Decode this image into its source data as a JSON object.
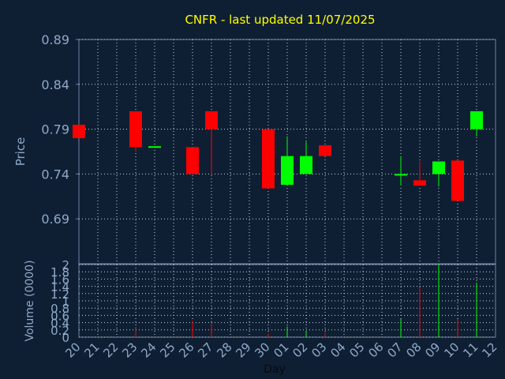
{
  "chart_data": {
    "type": "candlestick",
    "title": "CNFR - last updated 11/07/2025",
    "xlabel": "Day",
    "ylabel_price": "Price",
    "ylabel_volume": "Volume (0000)",
    "price_ylim": [
      0.64,
      0.89
    ],
    "price_ticks": [
      "0.89",
      "0.84",
      "0.79",
      "0.74",
      "0.69"
    ],
    "volume_ylim": [
      0,
      2
    ],
    "volume_ticks": [
      "2",
      "1.8",
      "1.6",
      "1.4",
      "1.2",
      "1",
      "0.8",
      "0.6",
      "0.4",
      "0.2",
      "0"
    ],
    "x_ticks": [
      "20",
      "21",
      "22",
      "23",
      "24",
      "25",
      "26",
      "27",
      "28",
      "29",
      "30",
      "01",
      "02",
      "03",
      "04",
      "05",
      "06",
      "07",
      "08",
      "09",
      "10",
      "11",
      "12"
    ],
    "grid": true,
    "colors": {
      "up": "#00ff00",
      "down": "#ff0000",
      "background": "#0f1f33",
      "text": "#8fa9c8",
      "title": "#ffff00",
      "frame": "#6f86a3"
    },
    "candles": [
      {
        "x": "20",
        "open": 0.795,
        "close": 0.78,
        "high": 0.795,
        "low": 0.78,
        "volume": 0.0
      },
      {
        "x": "23",
        "open": 0.81,
        "close": 0.77,
        "high": 0.81,
        "low": 0.765,
        "volume": 0.2
      },
      {
        "x": "24",
        "open": 0.77,
        "close": 0.771,
        "high": 0.771,
        "low": 0.77,
        "volume": 0.0
      },
      {
        "x": "26",
        "open": 0.77,
        "close": 0.74,
        "high": 0.77,
        "low": 0.74,
        "volume": 0.45
      },
      {
        "x": "27",
        "open": 0.81,
        "close": 0.79,
        "high": 0.81,
        "low": 0.74,
        "volume": 0.38
      },
      {
        "x": "30",
        "open": 0.79,
        "close": 0.724,
        "high": 0.79,
        "low": 0.724,
        "volume": 0.1
      },
      {
        "x": "01",
        "open": 0.728,
        "close": 0.76,
        "high": 0.782,
        "low": 0.728,
        "volume": 0.3
      },
      {
        "x": "02",
        "open": 0.74,
        "close": 0.76,
        "high": 0.776,
        "low": 0.74,
        "volume": 0.15
      },
      {
        "x": "03",
        "open": 0.772,
        "close": 0.76,
        "high": 0.772,
        "low": 0.76,
        "volume": 0.12
      },
      {
        "x": "07",
        "open": 0.739,
        "close": 0.74,
        "high": 0.76,
        "low": 0.727,
        "volume": 0.5
      },
      {
        "x": "08",
        "open": 0.733,
        "close": 0.727,
        "high": 0.754,
        "low": 0.727,
        "volume": 1.35
      },
      {
        "x": "09",
        "open": 0.74,
        "close": 0.754,
        "high": 0.754,
        "low": 0.726,
        "volume": 2.0
      },
      {
        "x": "10",
        "open": 0.755,
        "close": 0.71,
        "high": 0.755,
        "low": 0.71,
        "volume": 0.5
      },
      {
        "x": "11",
        "open": 0.79,
        "close": 0.81,
        "high": 0.81,
        "low": 0.782,
        "volume": 1.5
      }
    ]
  }
}
